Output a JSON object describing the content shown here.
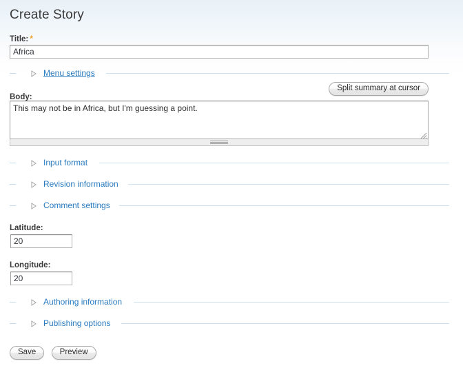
{
  "page": {
    "title": "Create Story"
  },
  "form": {
    "title_field": {
      "label": "Title:",
      "required_marker": "*",
      "value": "Africa",
      "placeholder": ""
    },
    "body_field": {
      "label": "Body:",
      "value": "This may not be in Africa, but I'm guessing a point.",
      "placeholder": "",
      "split_summary_button": "Split summary at cursor"
    },
    "latitude_field": {
      "label": "Latitude:",
      "value": "20",
      "placeholder": ""
    },
    "longitude_field": {
      "label": "Longitude:",
      "value": "20",
      "placeholder": ""
    }
  },
  "fieldsets": [
    {
      "legend": "Menu settings",
      "state": "collapsed",
      "marker": "collapsed-triangle-icon",
      "hovered": true
    },
    {
      "legend": "Input format",
      "state": "collapsed",
      "marker": "collapsed-triangle-icon",
      "hovered": false
    },
    {
      "legend": "Revision information",
      "state": "collapsed",
      "marker": "collapsed-triangle-icon",
      "hovered": false
    },
    {
      "legend": "Comment settings",
      "state": "collapsed",
      "marker": "collapsed-triangle-icon",
      "hovered": false
    },
    {
      "legend": "Authoring information",
      "state": "collapsed",
      "marker": "collapsed-triangle-icon",
      "hovered": false
    },
    {
      "legend": "Publishing options",
      "state": "collapsed",
      "marker": "collapsed-triangle-icon",
      "hovered": false
    }
  ],
  "actions": {
    "save_label": "Save",
    "preview_label": "Preview"
  },
  "colors": {
    "link": "#2a7bbf",
    "fieldset_line": "#cde3f4",
    "required_marker": "#f0a32e",
    "label_text": "#3a3a3a",
    "page_top_gradient": "#e9f1f7",
    "page_background": "#ffffff"
  }
}
